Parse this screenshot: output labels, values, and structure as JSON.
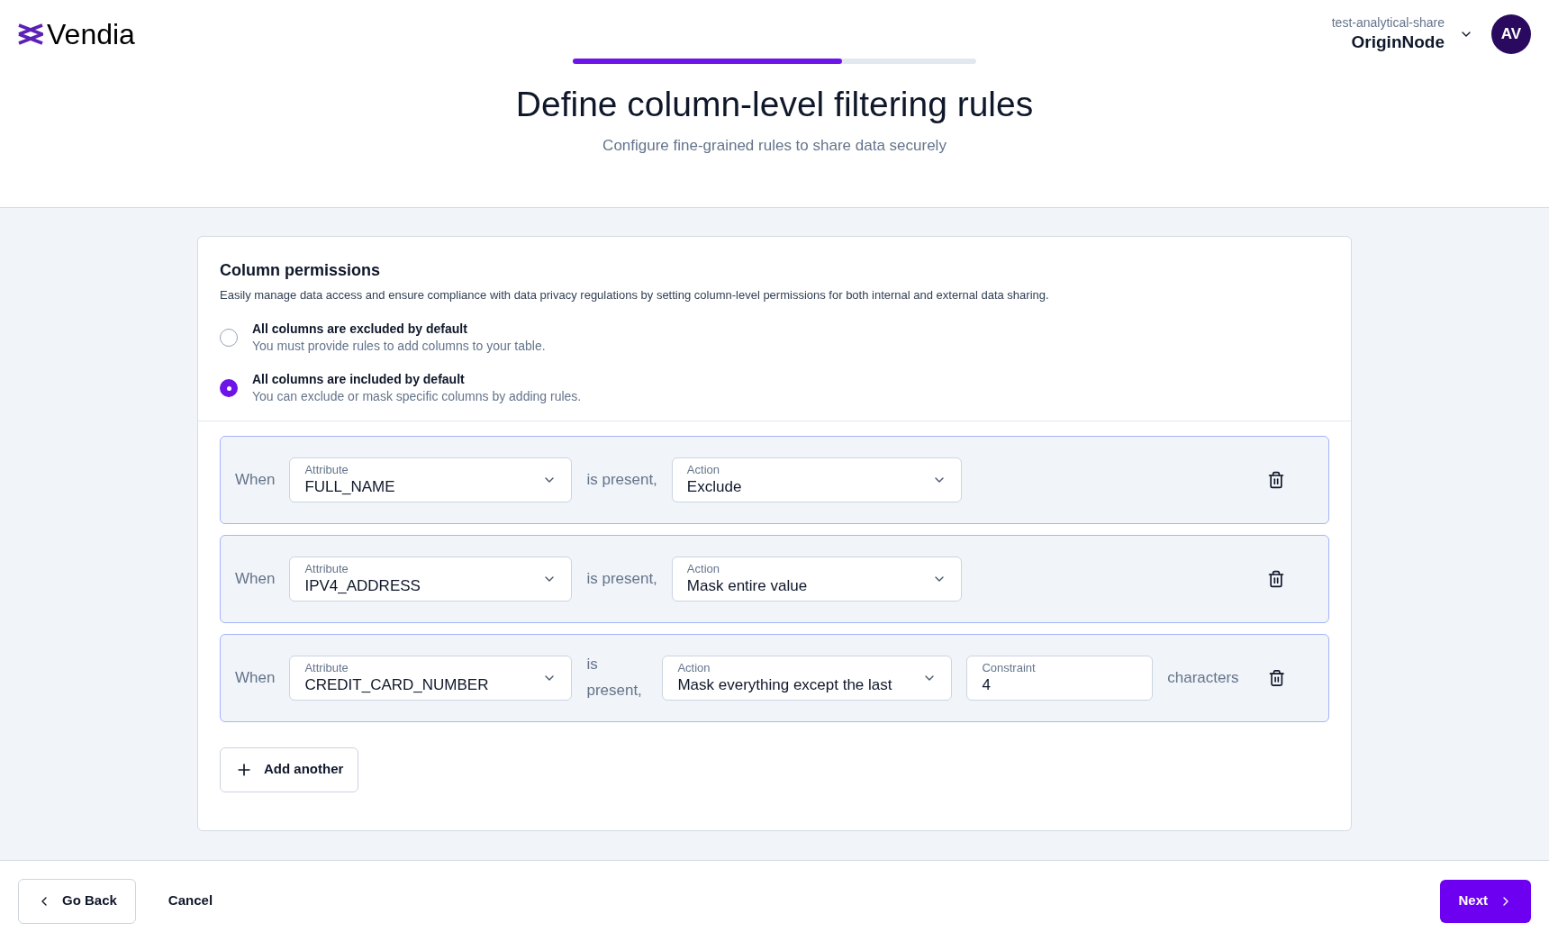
{
  "header": {
    "logo": "Vendia",
    "workspace": "test-analytical-share",
    "node": "OriginNode",
    "avatar": "AV"
  },
  "progress": {
    "level": 0.667
  },
  "page": {
    "title": "Define column-level filtering rules",
    "subtitle": "Configure fine-grained rules to share data securely"
  },
  "permissions": {
    "title": "Column permissions",
    "description": "Easily manage data access and ensure compliance with data privacy regulations by setting column-level permissions for both internal and external data sharing.",
    "options": [
      {
        "label": "All columns are excluded by default",
        "hint": "You must provide rules to add columns to your table.",
        "selected": false
      },
      {
        "label": "All columns are included by default",
        "hint": "You can exclude or mask specific columns by adding rules.",
        "selected": true
      }
    ]
  },
  "rules": [
    {
      "when": "When",
      "attribute_label": "Attribute",
      "attribute": "FULL_NAME",
      "present": "is present,",
      "action_label": "Action",
      "action": "Exclude"
    },
    {
      "when": "When",
      "attribute_label": "Attribute",
      "attribute": "IPV4_ADDRESS",
      "present": "is present,",
      "action_label": "Action",
      "action": "Mask entire value"
    },
    {
      "when": "When",
      "attribute_label": "Attribute",
      "attribute": "CREDIT_CARD_NUMBER",
      "present": "is present,",
      "action_label": "Action",
      "action": "Mask everything except the last",
      "constraint": {
        "label": "Constraint",
        "value": "4",
        "unit": "characters"
      }
    }
  ],
  "add_button": "Add another",
  "footer": {
    "back": "Go Back",
    "cancel": "Cancel",
    "next": "Next"
  }
}
